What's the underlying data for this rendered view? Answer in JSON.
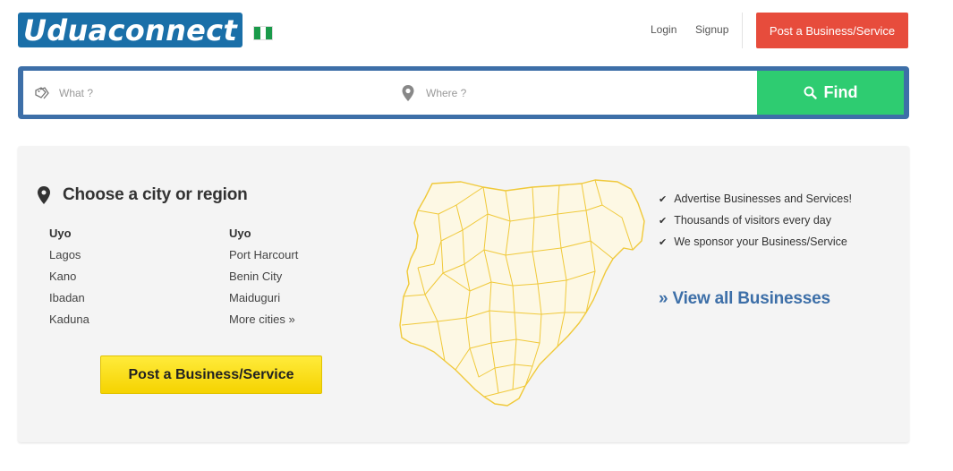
{
  "header": {
    "logo_text": "Uduaconnect",
    "login": "Login",
    "signup": "Signup",
    "post_button": "Post a Business/Service"
  },
  "search": {
    "what_placeholder": "What ?",
    "where_placeholder": "Where ?",
    "find_label": "Find"
  },
  "region": {
    "title": "Choose a city or region",
    "col1": [
      "Uyo",
      "Lagos",
      "Kano",
      "Ibadan",
      "Kaduna"
    ],
    "col2": [
      "Uyo",
      "Port Harcourt",
      "Benin City",
      "Maiduguri",
      "More cities »"
    ],
    "post_button": "Post a Business/Service"
  },
  "features": [
    "Advertise Businesses and Services!",
    "Thousands of visitors every day",
    "We sponsor your Business/Service"
  ],
  "view_all": "» View all Businesses",
  "colors": {
    "brand": "#1a6fa8",
    "search_border": "#3d6fa8",
    "find": "#2ecc71",
    "post_top": "#e74c3c",
    "post_yellow": "#ffeb3b",
    "map_fill": "#fdf8e4",
    "map_stroke": "#f0c93a"
  }
}
